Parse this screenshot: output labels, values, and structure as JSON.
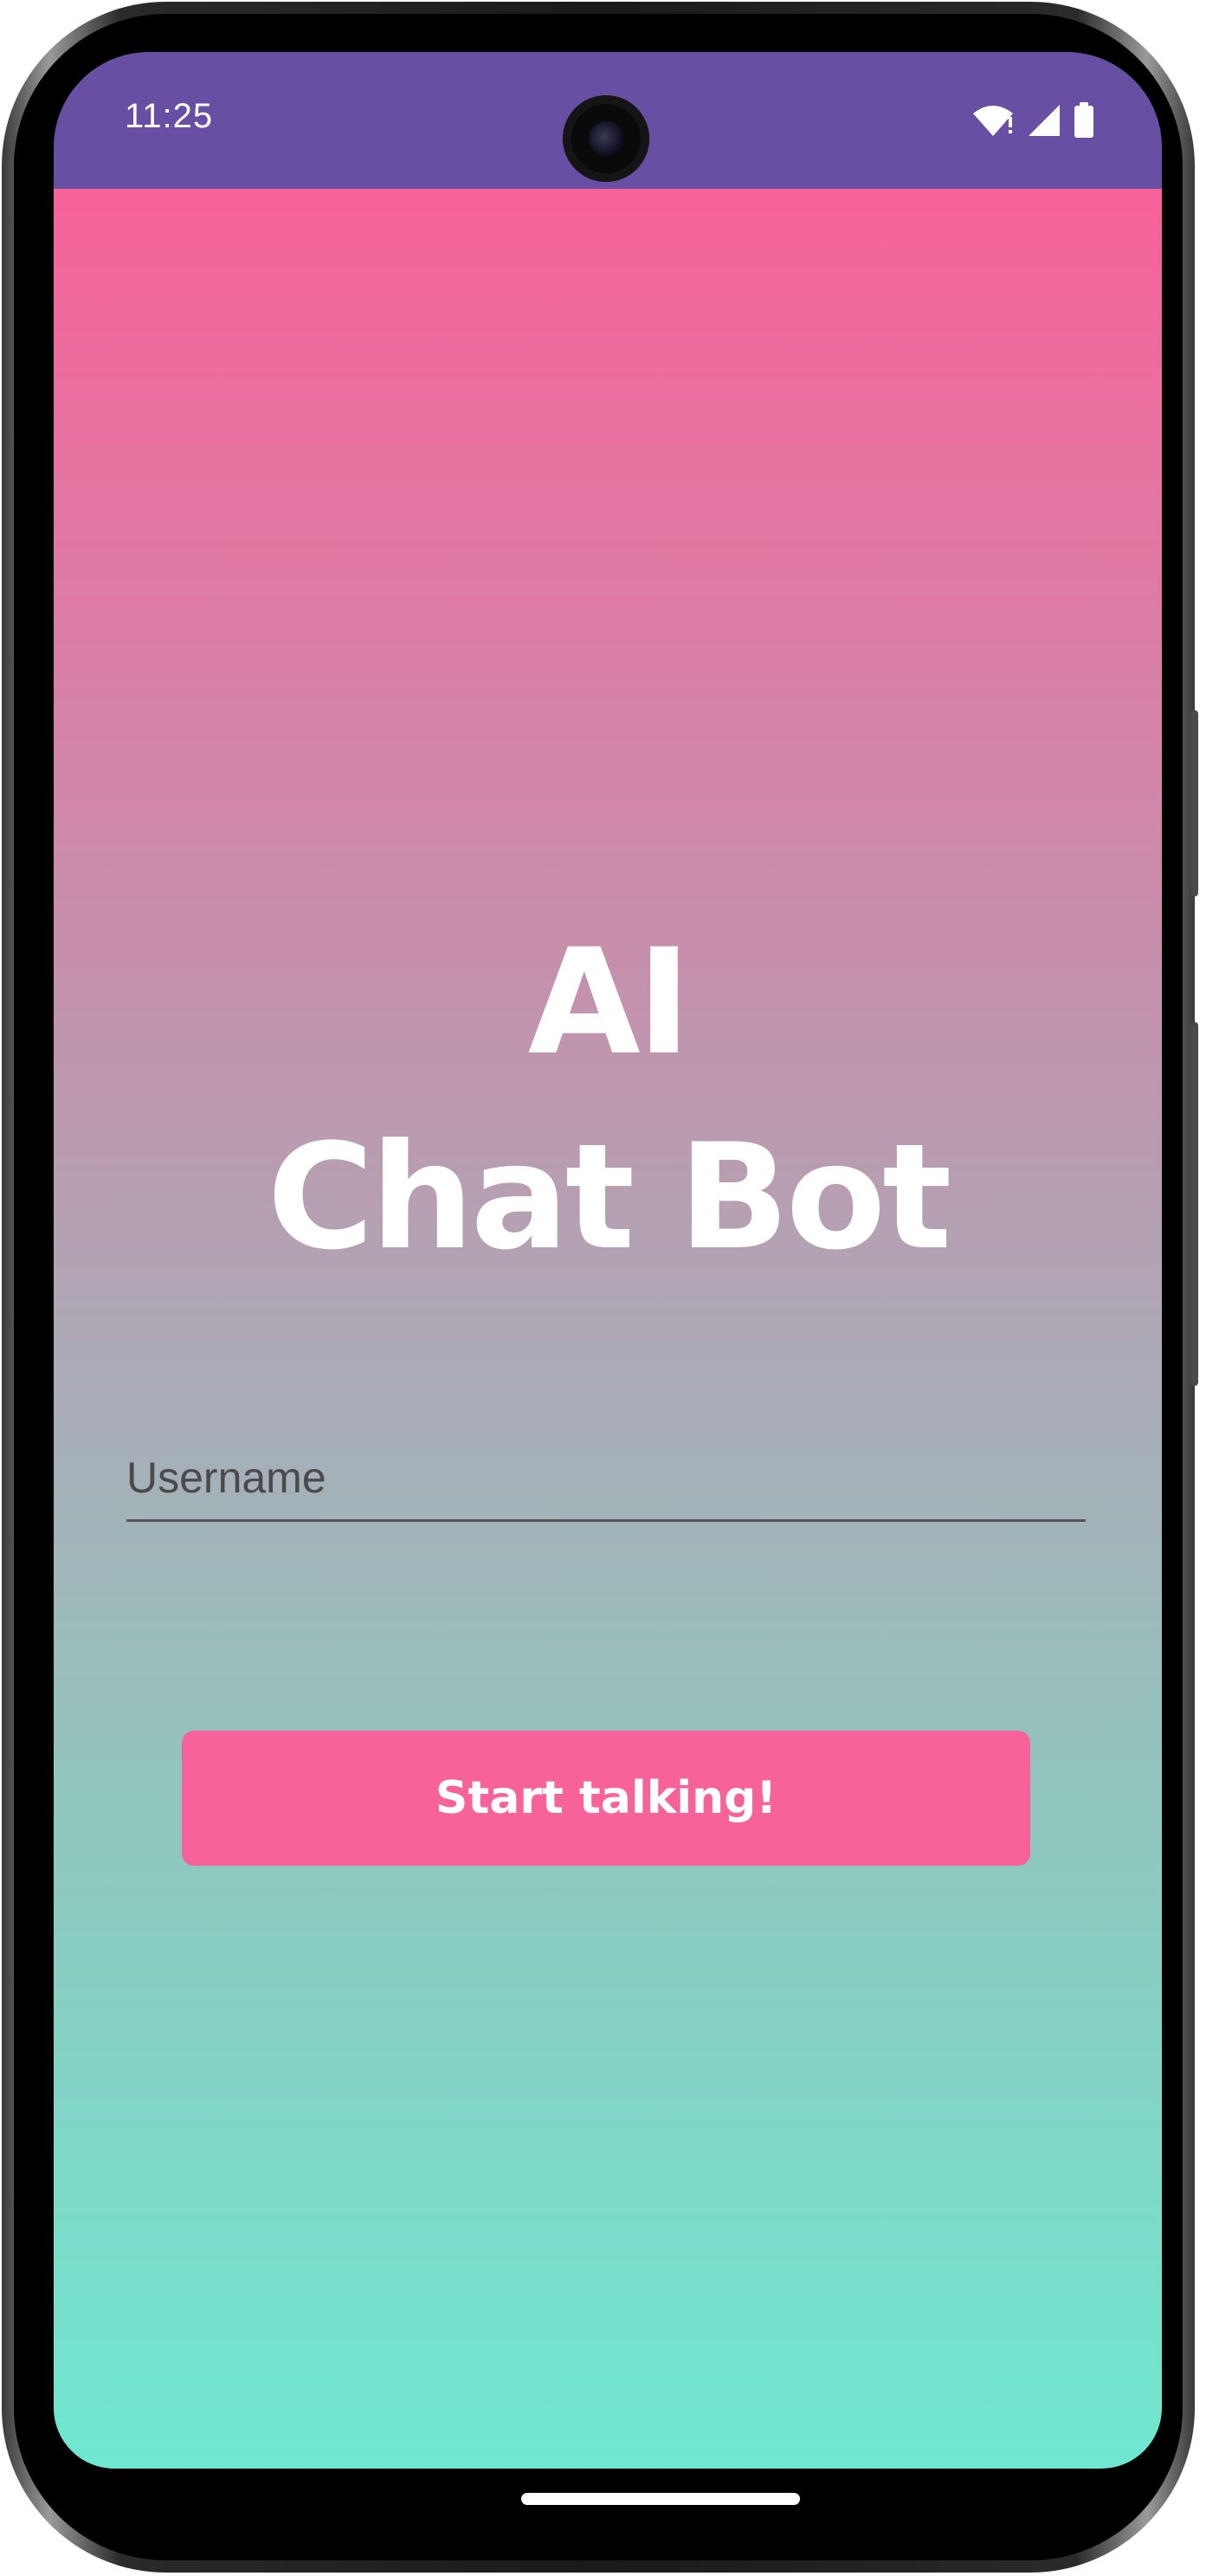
{
  "status_bar": {
    "time": "11:25",
    "icons": [
      "wifi-icon",
      "signal-icon",
      "battery-icon"
    ],
    "color": "#6750a4"
  },
  "app": {
    "title_line1": "AI",
    "title_line2": "Chat Bot",
    "username_placeholder": "Username",
    "username_value": "",
    "start_button_label": "Start talking!",
    "colors": {
      "gradient_top": "#f7629a",
      "gradient_bottom": "#6ee8d0",
      "button": "#f7629a",
      "text": "#ffffff"
    }
  }
}
